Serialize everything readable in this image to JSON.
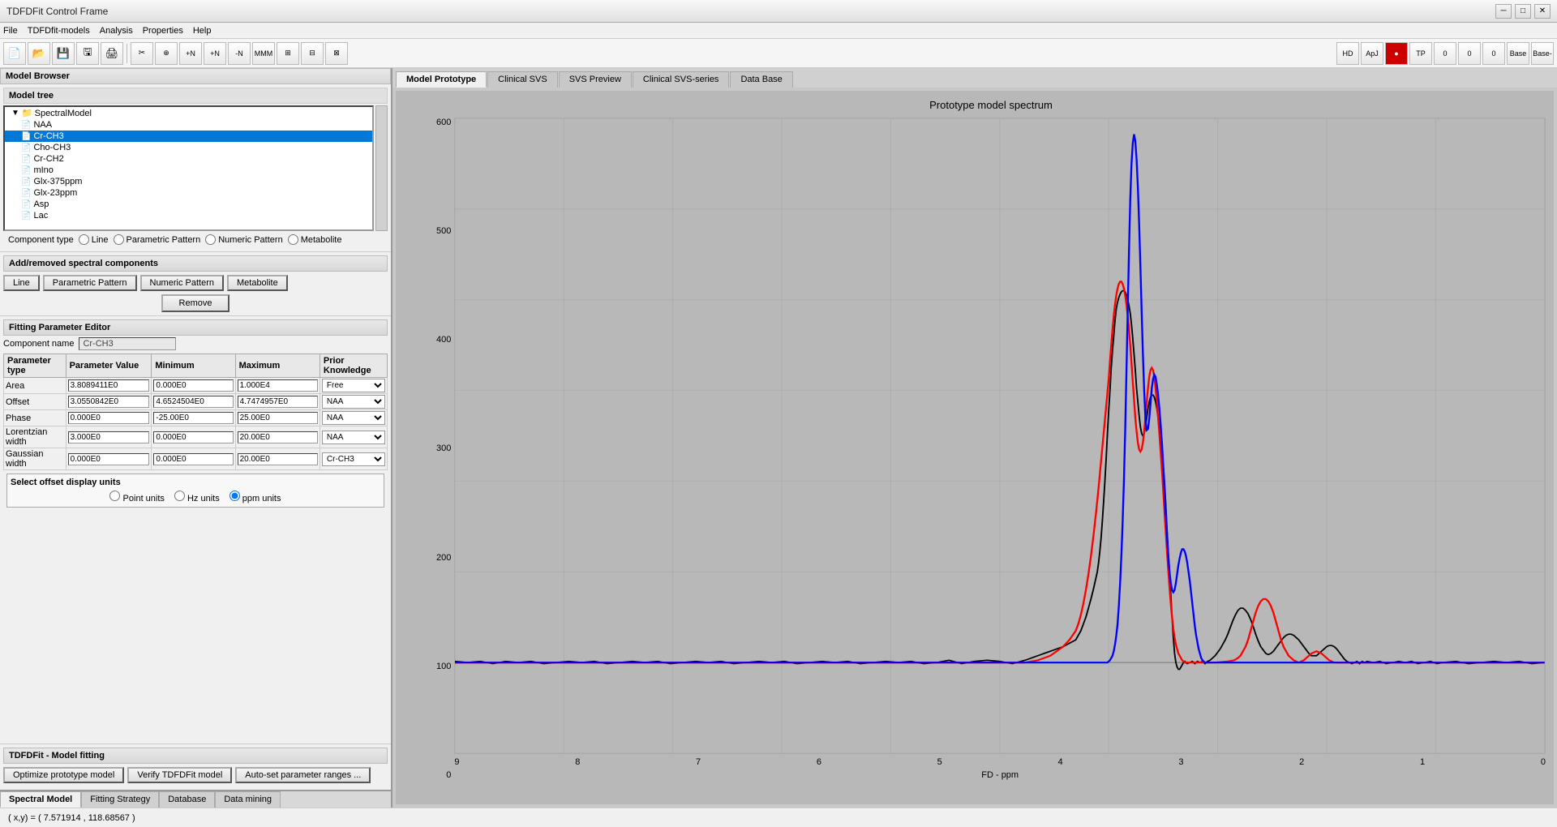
{
  "window": {
    "title": "TDFDFit Control Frame"
  },
  "menubar": {
    "items": [
      "File",
      "TDFDfit-models",
      "Analysis",
      "Properties",
      "Help"
    ]
  },
  "toolbar": {
    "buttons": [
      "📂",
      "💾",
      "🖨",
      "✂",
      "📋"
    ]
  },
  "left_panel": {
    "model_browser_title": "Model Browser",
    "model_tree_title": "Model tree",
    "tree_items": [
      {
        "label": "SpectralModel",
        "level": 1,
        "type": "folder",
        "selected": false
      },
      {
        "label": "NAA",
        "level": 2,
        "type": "file",
        "selected": false
      },
      {
        "label": "Cr-CH3",
        "level": 2,
        "type": "file",
        "selected": true
      },
      {
        "label": "Cho-CH3",
        "level": 2,
        "type": "file",
        "selected": false
      },
      {
        "label": "Cr-CH2",
        "level": 2,
        "type": "file",
        "selected": false
      },
      {
        "label": "mIno",
        "level": 2,
        "type": "file",
        "selected": false
      },
      {
        "label": "Glx-375ppm",
        "level": 2,
        "type": "file",
        "selected": false
      },
      {
        "label": "Glx-23ppm",
        "level": 2,
        "type": "file",
        "selected": false
      },
      {
        "label": "Asp",
        "level": 2,
        "type": "file",
        "selected": false
      },
      {
        "label": "Lac",
        "level": 2,
        "type": "file",
        "selected": false
      }
    ],
    "component_type_label": "Component type",
    "component_type_options": [
      "Line",
      "Parametric Pattern",
      "Numeric Pattern",
      "Metabolite"
    ],
    "add_remove_title": "Add/removed spectral components",
    "add_buttons": [
      "Line",
      "Parametric Pattern",
      "Numeric Pattern",
      "Metabolite"
    ],
    "remove_button": "Remove",
    "fitting_editor_title": "Fitting Parameter Editor",
    "component_name_label": "Component name",
    "component_name_value": "Cr-CH3",
    "param_headers": [
      "Parameter type",
      "Parameter Value",
      "Minimum",
      "Maximum",
      "Prior Knowledge"
    ],
    "params": [
      {
        "type": "Area",
        "value": "3.8089411E0",
        "min": "0.000E0",
        "max": "1.000E4",
        "prior": "Free"
      },
      {
        "type": "Offset",
        "value": "3.0550842E0",
        "min": "4.6524504E0",
        "max": "4.7474957E0",
        "prior": "NAA"
      },
      {
        "type": "Phase",
        "value": "0.000E0",
        "min": "-25.00E0",
        "max": "25.00E0",
        "prior": "NAA"
      },
      {
        "type": "Lorentzian width",
        "value": "3.000E0",
        "min": "0.000E0",
        "max": "20.00E0",
        "prior": "NAA"
      },
      {
        "type": "Gaussian width",
        "value": "0.000E0",
        "min": "0.000E0",
        "max": "20.00E0",
        "prior": "Cr-CH3"
      }
    ],
    "prior_options": [
      "Free",
      "NAA",
      "Cr-CH3"
    ],
    "offset_section_title": "Select offset display units",
    "offset_options": [
      "Point units",
      "Hz units",
      "ppm units"
    ],
    "offset_selected": "ppm units",
    "model_fitting_title": "TDFDFit - Model fitting",
    "model_fitting_buttons": [
      "Optimize prototype model",
      "Verify TDFDFit model",
      "Auto-set parameter ranges ..."
    ],
    "bottom_tabs": [
      "Spectral Model",
      "Fitting Strategy",
      "Database",
      "Data mining"
    ],
    "bottom_tab_active": "Spectral Model"
  },
  "right_panel": {
    "tabs": [
      "Model Prototype",
      "Clinical SVS",
      "SVS Preview",
      "Clinical SVS-series",
      "Data Base"
    ],
    "active_tab": "Model Prototype",
    "chart_title": "Prototype model spectrum",
    "x_axis_label": "FD - ppm",
    "y_axis_ticks": [
      "600",
      "500",
      "400",
      "300",
      "200",
      "100",
      "0"
    ],
    "x_axis_ticks": [
      "9",
      "8",
      "7",
      "6",
      "5",
      "4",
      "3",
      "2",
      "1",
      "0"
    ]
  },
  "status_bar": {
    "text": "( x,y) = ( 7.571914 , 118.68567 )"
  }
}
